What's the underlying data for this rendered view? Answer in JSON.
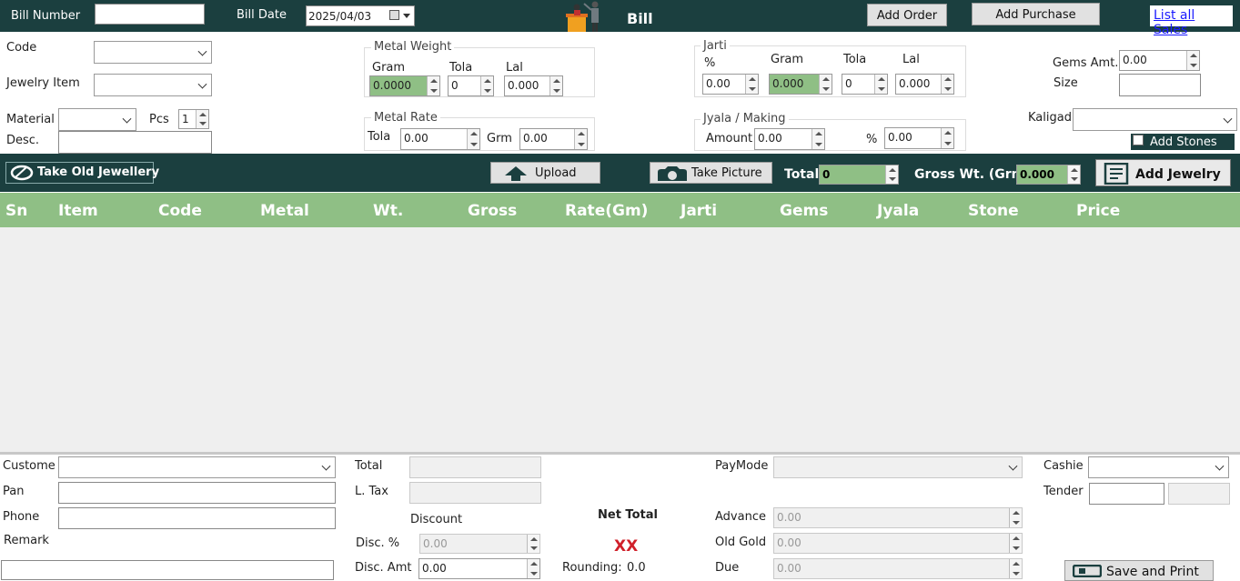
{
  "header": {
    "bill_number_label": "Bill Number",
    "bill_number_value": "",
    "bill_date_label": "Bill Date",
    "bill_date_value": "2025/04/03",
    "title": "Bill",
    "add_order": "Add Order",
    "add_purchase": "Add Purchase",
    "list_all_sales": "List all Sales"
  },
  "form": {
    "code_label": "Code",
    "jewelry_item_label": "Jewelry Item",
    "material_label": "Material",
    "pcs_label": "Pcs",
    "pcs_value": "1",
    "desc_label": "Desc.",
    "metal_weight": {
      "title": "Metal Weight",
      "gram_label": "Gram",
      "gram_value": "0.0000",
      "tola_label": "Tola",
      "tola_value": "0",
      "lal_label": "Lal",
      "lal_value": "0.000"
    },
    "metal_rate": {
      "title": "Metal Rate",
      "tola_label": "Tola",
      "tola_value": "0.00",
      "grm_label": "Grm",
      "grm_value": "0.00"
    },
    "jarti": {
      "title": "Jarti",
      "pct_label": "%",
      "pct_value": "0.00",
      "gram_label": "Gram",
      "gram_value": "0.000",
      "tola_label": "Tola",
      "tola_value": "0",
      "lal_label": "Lal",
      "lal_value": "0.000"
    },
    "jyala": {
      "title": "Jyala / Making",
      "amount_label": "Amount",
      "amount_value": "0.00",
      "pct_label": "%",
      "pct_value": "0.00"
    },
    "gems_amt_label": "Gems Amt.",
    "gems_amt_value": "0.00",
    "size_label": "Size",
    "kaligad_label": "Kaligad",
    "add_stones_label": "Add Stones"
  },
  "actions": {
    "take_old_jewellery": "Take Old Jewellery",
    "upload": "Upload",
    "take_picture": "Take Picture",
    "total_label": "Total",
    "total_value": "0",
    "gross_wt_label": "Gross Wt. (Grm)",
    "gross_wt_value": "0.000",
    "add_jewelry": "Add Jewelry"
  },
  "table": {
    "columns": [
      "Sn",
      "Item",
      "Code",
      "Metal",
      "Wt.",
      "Gross",
      "Rate(Gm)",
      "Jarti",
      "Gems",
      "Jyala",
      "Stone",
      "Price"
    ],
    "rows": []
  },
  "footer": {
    "customer_label": "Custome",
    "pan_label": "Pan",
    "phone_label": "Phone",
    "remark_label": "Remark",
    "total_label": "Total",
    "ltax_label": "L. Tax",
    "discount_label": "Discount",
    "disc_pct_label": "Disc. %",
    "disc_pct_value": "0.00",
    "disc_amt_label": "Disc. Amt",
    "disc_amt_value": "0.00",
    "net_total_label": "Net Total",
    "net_total_value": "XX",
    "rounding_label": "Rounding:",
    "rounding_value": "0.0",
    "paymode_label": "PayMode",
    "advance_label": "Advance",
    "advance_value": "0.00",
    "old_gold_label": "Old Gold",
    "old_gold_value": "0.00",
    "due_label": "Due",
    "due_value": "0.00",
    "cashier_label": "Cashie",
    "tender_label": "Tender",
    "save_print": "Save and Print"
  },
  "colors": {
    "dark_teal": "#1b3f3f",
    "green": "#8fbf85",
    "net_total_red": "#d0202a"
  }
}
